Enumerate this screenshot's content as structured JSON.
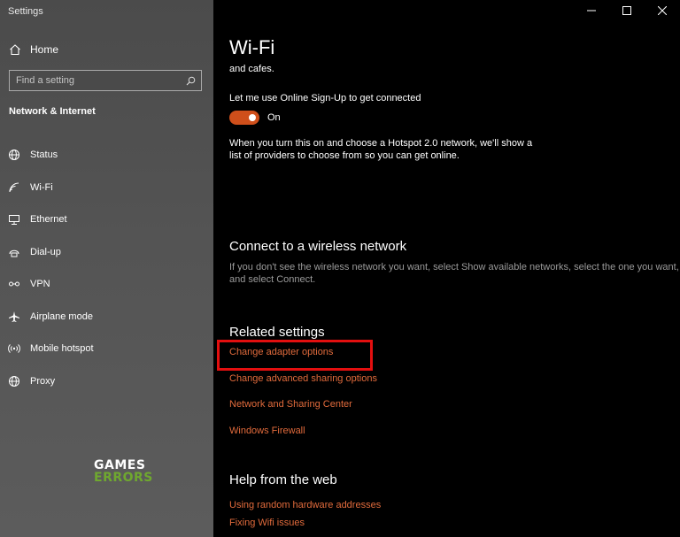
{
  "app": {
    "title": "Settings"
  },
  "sidebar": {
    "home_label": "Home",
    "search_placeholder": "Find a setting",
    "section_title": "Network & Internet",
    "items": [
      {
        "label": "Status",
        "icon": "globe-icon"
      },
      {
        "label": "Wi-Fi",
        "icon": "wifi-icon",
        "selected": true
      },
      {
        "label": "Ethernet",
        "icon": "ethernet-icon"
      },
      {
        "label": "Dial-up",
        "icon": "dialup-icon"
      },
      {
        "label": "VPN",
        "icon": "vpn-icon"
      },
      {
        "label": "Airplane mode",
        "icon": "airplane-icon"
      },
      {
        "label": "Mobile hotspot",
        "icon": "hotspot-icon"
      },
      {
        "label": "Proxy",
        "icon": "globe-icon"
      }
    ]
  },
  "watermark": {
    "line1": "GAMES",
    "line2": "ERRORS"
  },
  "main": {
    "title": "Wi-Fi",
    "partial_text": "and cafes.",
    "online_signup_label": "Let me use Online Sign-Up to get connected",
    "toggle_state": "On",
    "hotspot_desc_line1": "When you turn this on and choose a Hotspot 2.0 network, we'll show a",
    "hotspot_desc_line2": "list of providers to choose from so you can get online.",
    "connect_heading": "Connect to a wireless network",
    "connect_desc_line1": "If you don't see the wireless network you want, select Show available networks, select the one you want,",
    "connect_desc_line2": "and select Connect.",
    "related_heading": "Related settings",
    "related_links": [
      "Change adapter options",
      "Change advanced sharing options",
      "Network and Sharing Center",
      "Windows Firewall"
    ],
    "help_heading": "Help from the web",
    "help_links": [
      "Using random hardware addresses",
      "Fixing Wifi issues"
    ]
  },
  "colors": {
    "accent": "#cf4f1b",
    "link": "#e26b3c",
    "highlight": "#e30f0f",
    "watermark_green": "#6fa82f"
  }
}
